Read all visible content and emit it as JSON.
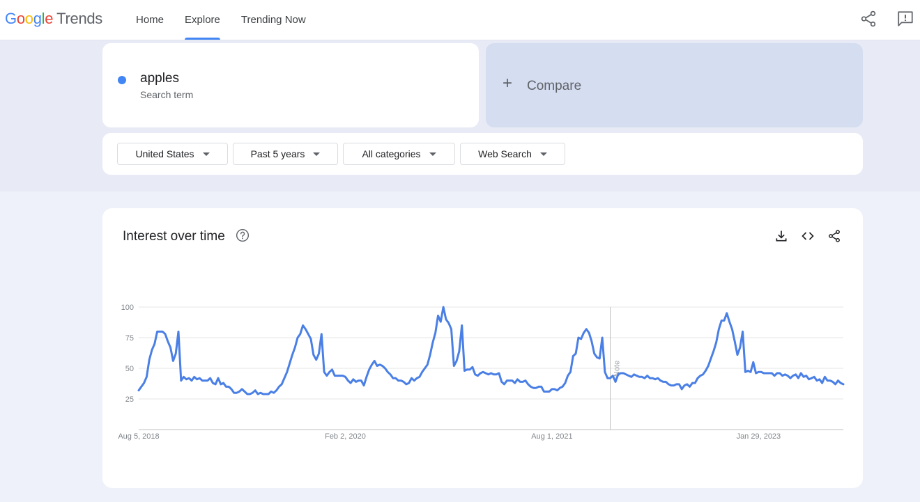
{
  "header": {
    "logo_parts": [
      "G",
      "o",
      "o",
      "g",
      "l",
      "e"
    ],
    "logo_product": "Trends",
    "nav": [
      {
        "label": "Home",
        "active": false
      },
      {
        "label": "Explore",
        "active": true
      },
      {
        "label": "Trending Now",
        "active": false
      }
    ],
    "icons": [
      "share-icon",
      "feedback-icon"
    ]
  },
  "search": {
    "term": "apples",
    "term_sub": "Search term",
    "term_color": "#4285f4",
    "compare_plus": "+",
    "compare_label": "Compare"
  },
  "filters": [
    {
      "label": "United States"
    },
    {
      "label": "Past 5 years"
    },
    {
      "label": "All categories"
    },
    {
      "label": "Web Search"
    }
  ],
  "panel": {
    "title": "Interest over time",
    "icons": [
      "help-icon",
      "download-icon",
      "embed-icon",
      "share-icon"
    ]
  },
  "chart_data": {
    "type": "line",
    "title": "",
    "xlabel": "",
    "ylabel": "",
    "ylim": [
      0,
      100
    ],
    "yticks": [
      25,
      50,
      75,
      100
    ],
    "x_tick_labels": [
      "Aug 5, 2018",
      "Feb 2, 2020",
      "Aug 1, 2021",
      "Jan 29, 2023"
    ],
    "x_tick_week_index": [
      0,
      78,
      156,
      234
    ],
    "note_week_index": 178,
    "note_label": "Note",
    "grid": true,
    "line_color": "#4a7fe5",
    "series": [
      {
        "values": [
          32,
          35,
          38,
          43,
          57,
          65,
          70,
          80,
          80,
          80,
          78,
          72,
          67,
          56,
          62,
          80,
          40,
          43,
          41,
          42,
          40,
          43,
          41,
          42,
          40,
          40,
          40,
          42,
          38,
          37,
          42,
          37,
          38,
          35,
          35,
          33,
          30,
          30,
          31,
          33,
          31,
          29,
          29,
          30,
          32,
          29,
          30,
          29,
          29,
          29,
          31,
          30,
          32,
          35,
          37,
          42,
          47,
          54,
          61,
          67,
          75,
          78,
          85,
          82,
          78,
          74,
          61,
          57,
          62,
          78,
          47,
          44,
          47,
          49,
          44,
          44,
          44,
          44,
          43,
          40,
          38,
          41,
          39,
          40,
          40,
          36,
          43,
          49,
          53,
          56,
          52,
          53,
          52,
          50,
          47,
          45,
          42,
          42,
          40,
          40,
          39,
          37,
          38,
          42,
          40,
          42,
          43,
          47,
          50,
          53,
          61,
          71,
          79,
          93,
          88,
          100,
          90,
          87,
          82,
          52,
          56,
          64,
          85,
          48,
          49,
          49,
          51,
          45,
          44,
          46,
          47,
          46,
          45,
          46,
          45,
          45,
          46,
          39,
          37,
          40,
          40,
          40,
          38,
          41,
          39,
          39,
          40,
          37,
          35,
          34,
          34,
          35,
          35,
          31,
          31,
          31,
          33,
          33,
          32,
          34,
          35,
          38,
          44,
          47,
          60,
          62,
          75,
          74,
          79,
          82,
          79,
          72,
          62,
          59,
          58,
          75,
          47,
          42,
          42,
          44,
          39,
          45,
          46,
          46,
          45,
          44,
          43,
          45,
          44,
          43,
          43,
          42,
          44,
          42,
          42,
          41,
          42,
          40,
          39,
          39,
          37,
          36,
          36,
          37,
          37,
          33,
          36,
          37,
          35,
          38,
          38,
          42,
          44,
          45,
          48,
          52,
          58,
          64,
          71,
          82,
          89,
          89,
          95,
          88,
          82,
          72,
          61,
          67,
          80,
          47,
          48,
          47,
          55,
          46,
          47,
          47,
          46,
          46,
          46,
          46,
          44,
          46,
          46,
          44,
          45,
          44,
          42,
          44,
          45,
          42,
          46,
          43,
          44,
          41,
          42,
          43,
          40,
          41,
          38,
          43,
          40,
          40,
          39,
          37,
          40,
          38,
          37
        ]
      }
    ]
  }
}
